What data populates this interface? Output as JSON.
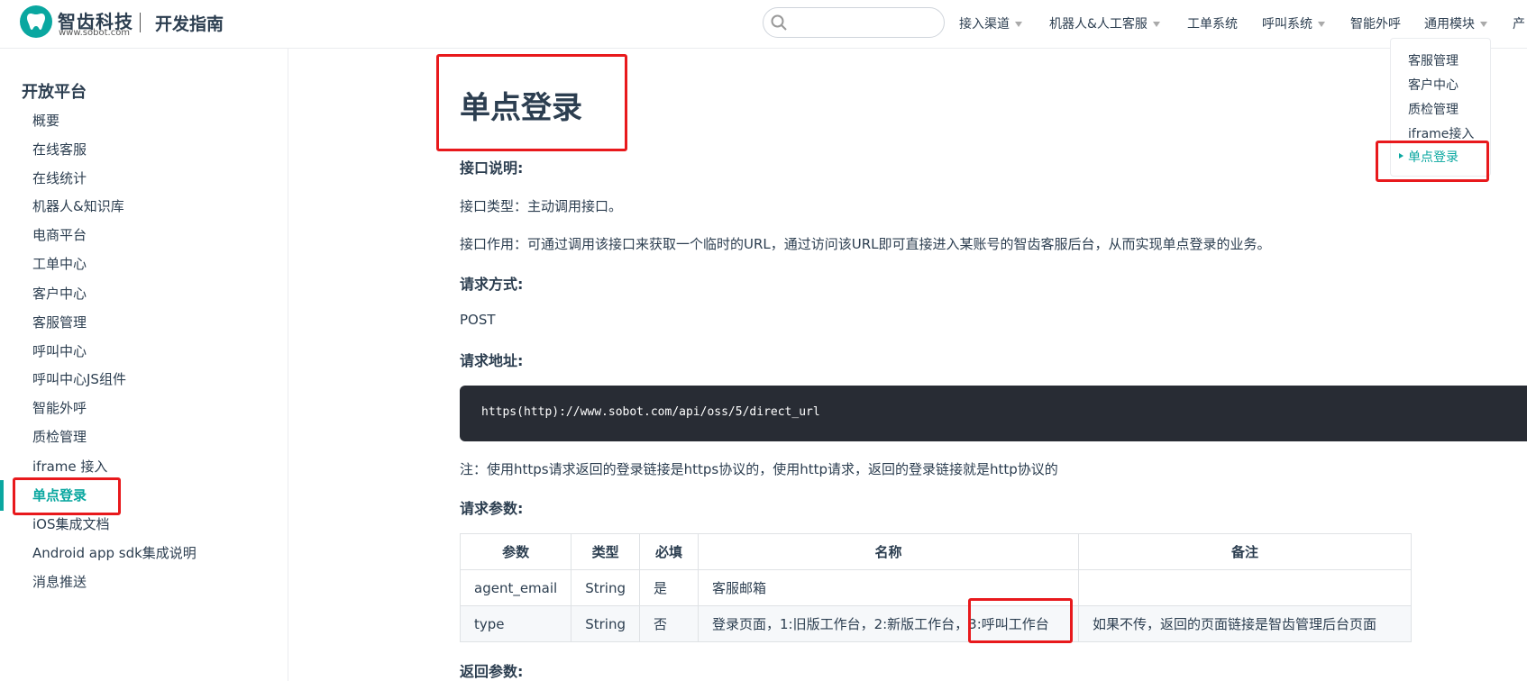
{
  "brand": {
    "name": "智齿科技",
    "domain": "www.sobot.com",
    "site_title": "开发指南"
  },
  "search": {
    "value": "",
    "placeholder": ""
  },
  "nav": [
    {
      "label": "接入渠道",
      "dropdown": true
    },
    {
      "label": "机器人&人工客服",
      "dropdown": true
    },
    {
      "label": "工单系统",
      "dropdown": false
    },
    {
      "label": "呼叫系统",
      "dropdown": true
    },
    {
      "label": "智能外呼",
      "dropdown": false
    },
    {
      "label": "通用模块",
      "dropdown": true
    },
    {
      "label": "产",
      "dropdown": false
    }
  ],
  "sidebar": {
    "heading": "开放平台",
    "items": [
      "概要",
      "在线客服",
      "在线统计",
      "机器人&知识库",
      "电商平台",
      "工单中心",
      "客户中心",
      "客服管理",
      "呼叫中心",
      "呼叫中心JS组件",
      "智能外呼",
      "质检管理",
      "iframe 接入",
      "单点登录",
      "iOS集成文档",
      "Android app sdk集成说明",
      "消息推送"
    ],
    "active_index": 13
  },
  "toc": {
    "items": [
      "客服管理",
      "客户中心",
      "质检管理",
      "iframe接入",
      "单点登录"
    ],
    "active_index": 4
  },
  "content": {
    "title": "单点登录",
    "intro_heading": "接口说明:",
    "type_line": "接口类型：主动调用接口。",
    "purpose_line": "接口作用：可通过调用该接口来获取一个临时的URL，通过访问该URL即可直接进入某账号的智齿客服后台，从而实现单点登录的业务。",
    "method_heading": "请求方式:",
    "method": "POST",
    "url_heading": "请求地址:",
    "url": "https(http)://www.sobot.com/api/oss/5/direct_url",
    "note": "注：使用https请求返回的登录链接是https协议的，使用http请求，返回的登录链接就是http协议的",
    "params_heading": "请求参数:",
    "table": {
      "headers": [
        "参数",
        "类型",
        "必填",
        "名称",
        "备注"
      ],
      "rows": [
        [
          "agent_email",
          "String",
          "是",
          "客服邮箱",
          ""
        ],
        [
          "type",
          "String",
          "否",
          "登录页面，1:旧版工作台，2:新版工作台，3:呼叫工作台",
          "如果不传，返回的页面链接是智齿管理后台页面"
        ]
      ]
    },
    "return_heading": "返回参数:"
  },
  "colors": {
    "accent": "#0aa7a0",
    "annotation": "#e8191c",
    "code_bg": "#282c34",
    "text": "#2c3e50"
  }
}
